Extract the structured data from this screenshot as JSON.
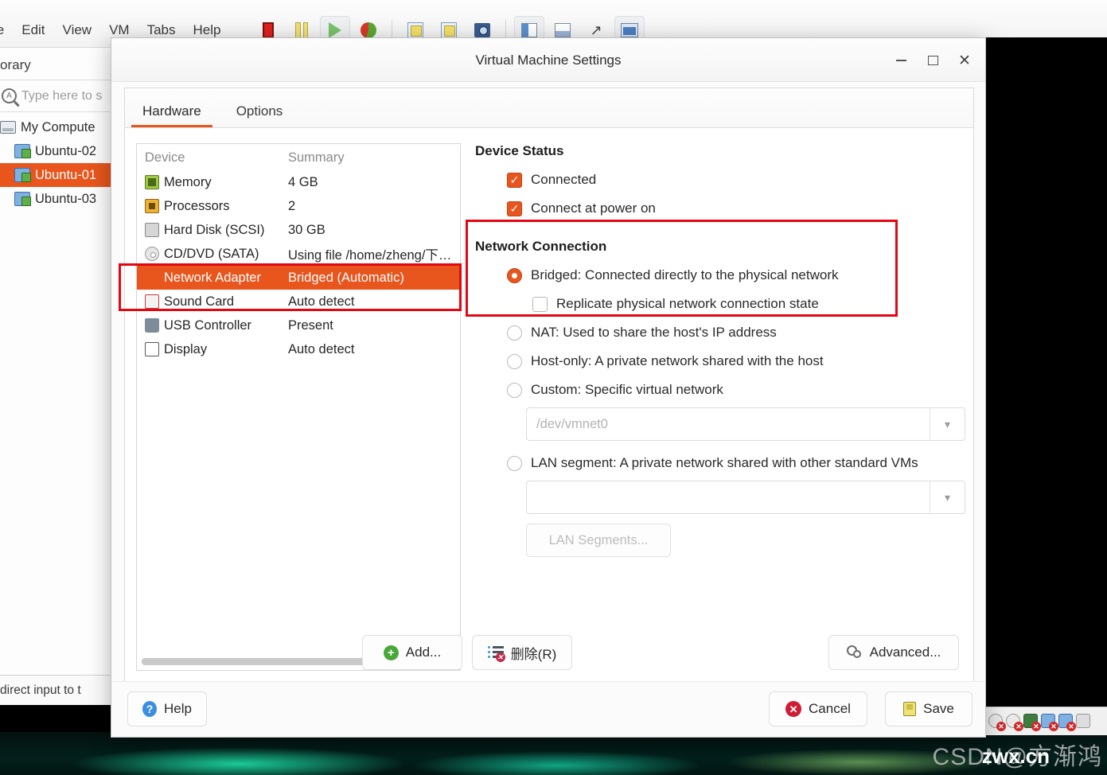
{
  "host": {
    "menu": [
      "le",
      "Edit",
      "View",
      "VM",
      "Tabs",
      "Help"
    ],
    "toolbar_icons": [
      "power-off-icon",
      "suspend-icon",
      "play-icon",
      "revert-snapshot-icon",
      "snapshot-manager-icon",
      "take-snapshot-icon",
      "manage-snapshots-icon",
      "show-library-icon",
      "show-thumbnails-icon",
      "fullscreen-icon",
      "unity-mode-icon"
    ]
  },
  "library": {
    "title": "orary",
    "search": {
      "placeholder": "Type here to s"
    },
    "tree": [
      {
        "label": "My Compute",
        "icon": "my-computer-icon",
        "selected": false,
        "child": false
      },
      {
        "label": "Ubuntu-02",
        "icon": "vm-icon",
        "selected": false,
        "child": true
      },
      {
        "label": "Ubuntu-01",
        "icon": "vm-icon",
        "selected": true,
        "child": true
      },
      {
        "label": "Ubuntu-03",
        "icon": "vm-icon",
        "selected": false,
        "child": true
      }
    ],
    "status_text": "direct input to t"
  },
  "dialog": {
    "title": "Virtual Machine Settings",
    "window_controls": {
      "minimize": "minimize-icon",
      "maximize": "maximize-icon",
      "close": "close-icon"
    },
    "tabs": [
      {
        "label": "Hardware",
        "active": true
      },
      {
        "label": "Options",
        "active": false
      }
    ],
    "device_table": {
      "headers": {
        "device": "Device",
        "summary": "Summary"
      },
      "rows": [
        {
          "device": "Memory",
          "summary": "4 GB",
          "icon": "memory-icon",
          "selected": false
        },
        {
          "device": "Processors",
          "summary": "2",
          "icon": "processor-icon",
          "selected": false
        },
        {
          "device": "Hard Disk (SCSI)",
          "summary": "30 GB",
          "icon": "hard-disk-icon",
          "selected": false
        },
        {
          "device": "CD/DVD (SATA)",
          "summary": "Using file /home/zheng/下…",
          "icon": "cd-dvd-icon",
          "selected": false
        },
        {
          "device": "Network Adapter",
          "summary": "Bridged (Automatic)",
          "icon": "network-adapter-icon",
          "selected": true
        },
        {
          "device": "Sound Card",
          "summary": "Auto detect",
          "icon": "sound-card-icon",
          "selected": false
        },
        {
          "device": "USB Controller",
          "summary": "Present",
          "icon": "usb-controller-icon",
          "selected": false
        },
        {
          "device": "Display",
          "summary": "Auto detect",
          "icon": "display-icon",
          "selected": false
        }
      ]
    },
    "device_status": {
      "title": "Device Status",
      "connected": {
        "label": "Connected",
        "checked": true
      },
      "connect_at_power_on": {
        "label": "Connect at power on",
        "checked": true
      }
    },
    "network_connection": {
      "title": "Network Connection",
      "options": [
        {
          "label": "Bridged: Connected directly to the physical network",
          "checked": true
        },
        {
          "label": "NAT: Used to share the host's IP address",
          "checked": false
        },
        {
          "label": "Host-only: A private network shared with the host",
          "checked": false
        },
        {
          "label": "Custom: Specific virtual network",
          "checked": false
        },
        {
          "label": "LAN segment: A private network shared with other standard VMs",
          "checked": false
        }
      ],
      "replicate": {
        "label": "Replicate physical network connection state",
        "checked": false
      },
      "custom_select": {
        "value": "/dev/vmnet0"
      },
      "lan_select": {
        "value": ""
      },
      "lan_segments_button": "LAN Segments..."
    },
    "buttons": {
      "add": "Add...",
      "remove": "删除(R)",
      "advanced": "Advanced...",
      "help": "Help",
      "cancel": "Cancel",
      "save": "Save"
    }
  },
  "annotations": {
    "device_row_highlight": "red-box-network-adapter-row",
    "network_section_highlight": "red-box-network-connection-section",
    "color": "#e30613"
  },
  "watermark": {
    "text": "CSDN@方渐鸿",
    "overlay": "zwx.cn"
  },
  "colors": {
    "accent": "#e8551d",
    "annotation_red": "#e30613",
    "dialog_bg": "#fbfbfb"
  }
}
